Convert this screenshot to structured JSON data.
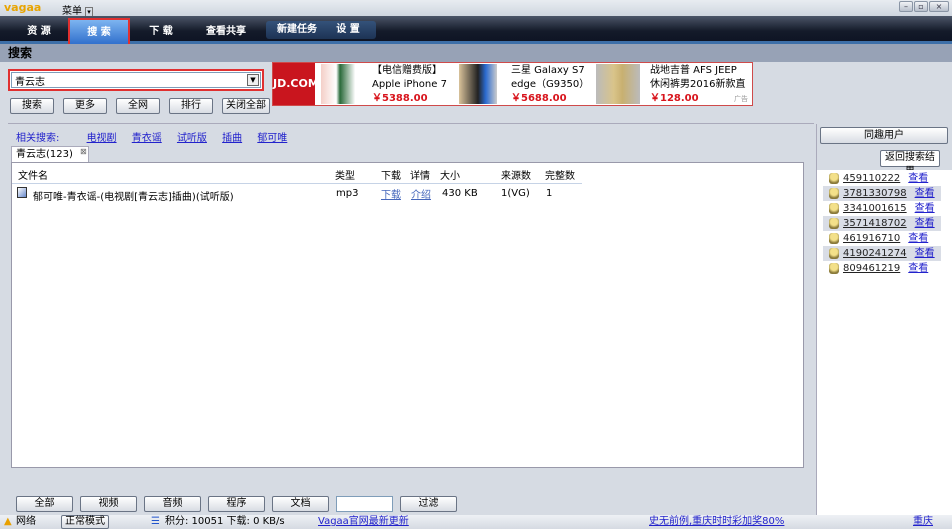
{
  "app": {
    "logo": "vagaa",
    "menu": "菜单"
  },
  "window_controls": {
    "minimize": "–",
    "maximize": "▫",
    "close": "×"
  },
  "nav": {
    "items": [
      "资 源",
      "搜 索",
      "下 载",
      "查看共享"
    ],
    "selected": "搜 索",
    "group": [
      "新建任务",
      "设 置"
    ]
  },
  "section_title": "搜索",
  "search": {
    "value": "青云志",
    "buttons": [
      "搜索",
      "更多",
      "全网",
      "排行",
      "关闭全部"
    ]
  },
  "ad": {
    "brand": "JD.COM",
    "items": [
      {
        "line1": "【电信赠费版】",
        "line2": "Apple iPhone 7",
        "price": "￥5388.00"
      },
      {
        "line1": "三星 Galaxy S7",
        "line2": "edge（G9350）",
        "price": "￥5688.00"
      },
      {
        "line1": "战地吉普 AFS JEEP",
        "line2": "休闲裤男2016新款直",
        "price": "￥128.00"
      }
    ],
    "badge": "广告"
  },
  "related": {
    "label": "相关搜索:",
    "links": [
      "电视剧",
      "青衣谣",
      "试听版",
      "插曲",
      "郁可唯"
    ]
  },
  "tab": {
    "label": "青云志(123)",
    "close": "⊠"
  },
  "table": {
    "headers": [
      "文件名",
      "类型",
      "下载",
      "详情",
      "大小",
      "来源数",
      "完整数"
    ],
    "rows": [
      {
        "name": "郁可唯-青衣谣-(电视剧[青云志]插曲)(试听版)",
        "type": "mp3",
        "download": "下载",
        "detail": "介绍",
        "size": "430 KB",
        "sources": "1(VG)",
        "complete": "1"
      }
    ]
  },
  "filters": {
    "buttons": [
      "全部",
      "视频",
      "音频",
      "程序",
      "文档"
    ],
    "input": "",
    "apply": "过滤"
  },
  "right": {
    "title": "同趣用户",
    "back": "返回搜索结果",
    "view": "查看",
    "users": [
      "459110222",
      "3781330798",
      "3341001615",
      "3571418702",
      "461916710",
      "4190241274",
      "809461219"
    ]
  },
  "status": {
    "network": "网络",
    "mode": "正常模式",
    "points": "积分: 10051  下载: 0 KB/s",
    "update": "Vagaa官网最新更新",
    "promo": "史无前例,重庆时时彩加奖80%",
    "right": "重庆"
  }
}
